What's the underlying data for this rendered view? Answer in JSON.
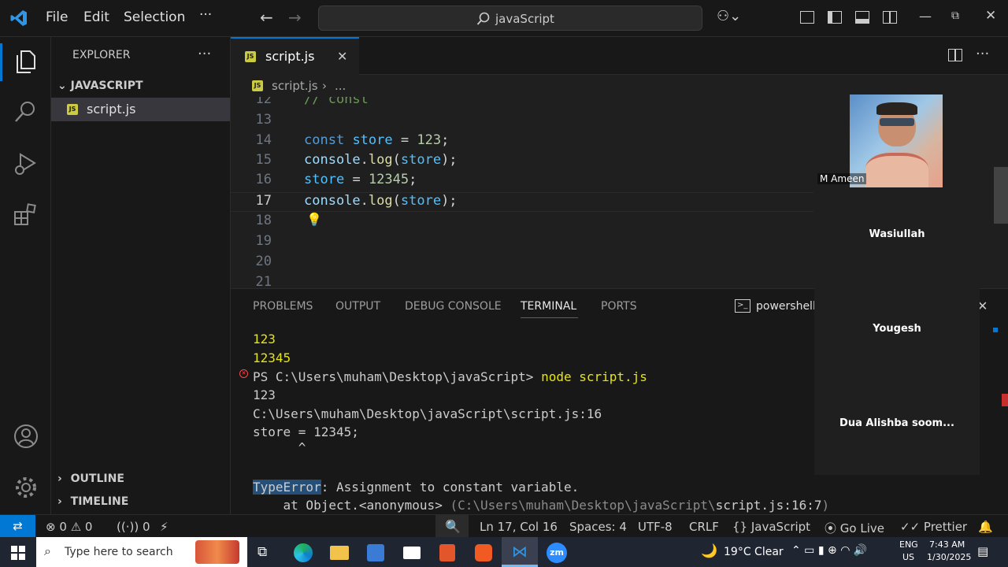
{
  "titlebar": {
    "menu": [
      "File",
      "Edit",
      "Selection",
      "···"
    ],
    "search_text": "javaScript"
  },
  "sidebar": {
    "header": "EXPLORER",
    "more": "···",
    "folder": "JAVASCRIPT",
    "file": "script.js",
    "outline": "OUTLINE",
    "timeline": "TIMELINE"
  },
  "editor": {
    "tab_label": "script.js",
    "breadcrumb_file": "script.js",
    "breadcrumb_more": "...",
    "badge": "JS",
    "lines": [
      {
        "n": "12",
        "t": "// const"
      },
      {
        "n": "13",
        "t": ""
      },
      {
        "n": "14",
        "t": "const store = 123;"
      },
      {
        "n": "15",
        "t": "console.log(store);"
      },
      {
        "n": "16",
        "t": "store = 12345;"
      },
      {
        "n": "17",
        "t": "console.log(store);"
      },
      {
        "n": "18",
        "t": ""
      },
      {
        "n": "19",
        "t": ""
      },
      {
        "n": "20",
        "t": ""
      },
      {
        "n": "21",
        "t": ""
      }
    ],
    "active_line": "17"
  },
  "panel": {
    "tabs": [
      "PROBLEMS",
      "OUTPUT",
      "DEBUG CONSOLE",
      "TERMINAL",
      "PORTS"
    ],
    "active_tab": "TERMINAL",
    "shell": "powershell",
    "terminal_lines": [
      "123",
      "12345",
      "PS C:\\Users\\muham\\Desktop\\javaScript> node script.js",
      "123",
      "C:\\Users\\muham\\Desktop\\javaScript\\script.js:16",
      "store = 12345;",
      "      ^",
      "",
      "TypeError: Assignment to constant variable.",
      "    at Object.<anonymous> (C:\\Users\\muham\\Desktop\\javaScript\\script.js:16:7)"
    ],
    "prompt": "PS C:\\Users\\muham\\Desktop\\javaScript>",
    "command": "node script.js",
    "error_type": "TypeError",
    "error_msg": ": Assignment to constant variable.",
    "stack_prefix": "    at Object.<anonymous> ",
    "stack_path": "(C:\\Users\\muham\\Desktop\\javaScript\\",
    "stack_file": "script.js:16:7",
    "stack_close": ")"
  },
  "participants": [
    {
      "name": "M Ameen"
    },
    {
      "name": "Wasiullah"
    },
    {
      "name": "Yougesh"
    },
    {
      "name": "Dua Alishba soom..."
    }
  ],
  "statusbar": {
    "errors": "0",
    "warnings": "0",
    "ports": "0",
    "position": "Ln 17, Col 16",
    "spaces": "Spaces: 4",
    "encoding": "UTF-8",
    "eol": "CRLF",
    "language": "JavaScript",
    "golive": "Go Live",
    "prettier": "Prettier"
  },
  "taskbar": {
    "search_placeholder": "Type here to search",
    "weather": "19°C  Clear",
    "lang1": "ENG",
    "lang2": "US",
    "time": "7:43 AM",
    "date": "1/30/2025",
    "zoom_label": "zm"
  },
  "colors": {
    "accent": "#0078d4",
    "keyword": "#569cd6",
    "variable": "#4fc1ff",
    "function": "#dcdcaa",
    "number": "#b5cea8",
    "comment": "#6a9955",
    "terminal_yellow": "#e5e510",
    "error_red": "#f14c4c"
  }
}
